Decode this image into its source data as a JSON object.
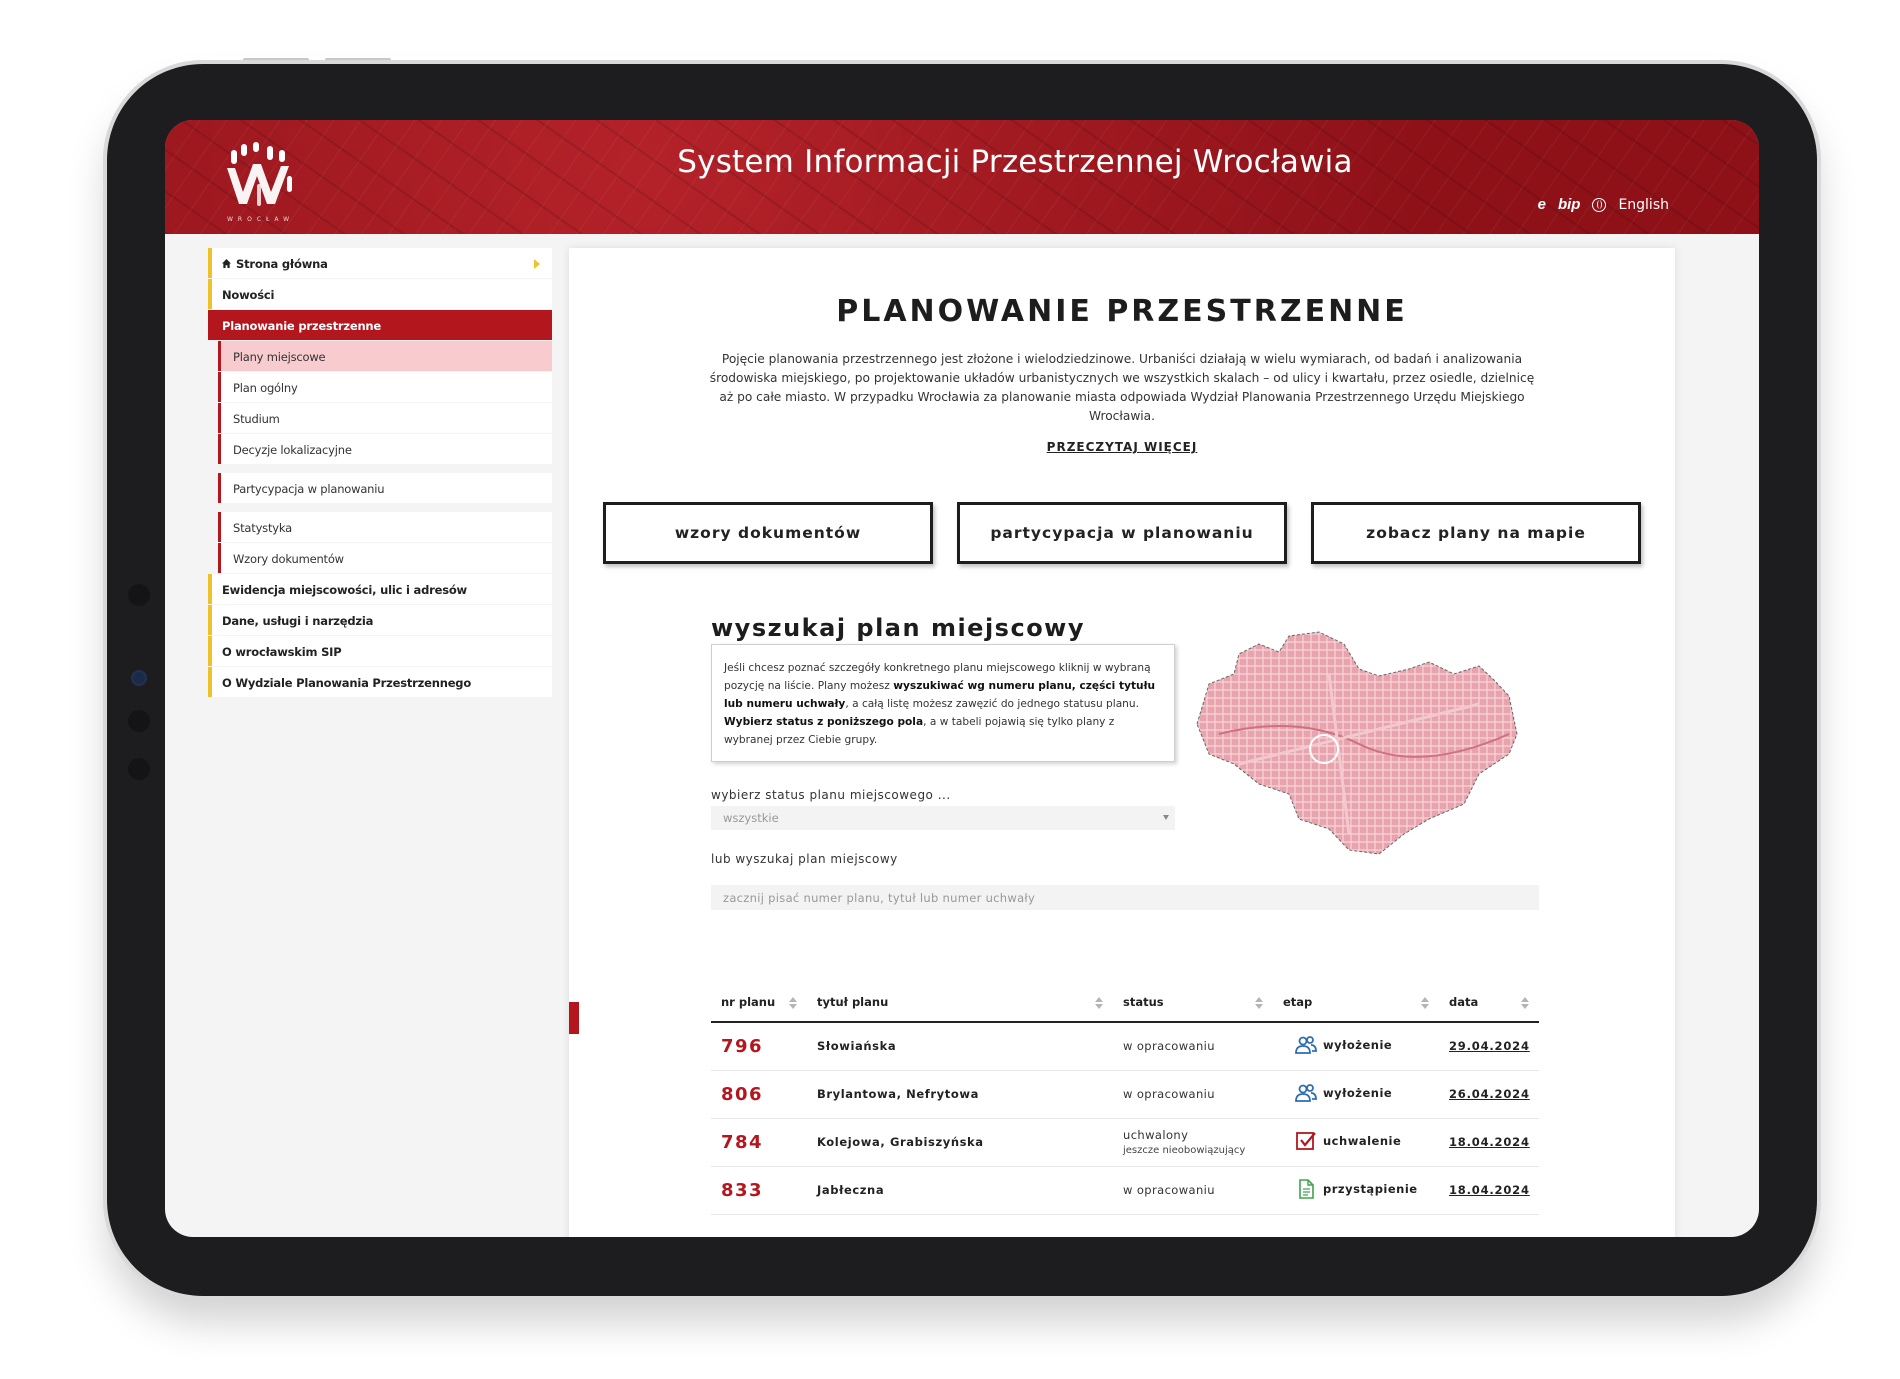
{
  "header": {
    "site_title": "System Informacji Przestrzennej Wrocławia",
    "logo_caption": "WROCŁAW",
    "links": {
      "e_label": "e",
      "bip_label": "bip",
      "lang_label": "English"
    }
  },
  "sidebar": {
    "items": [
      {
        "label": "Strona główna"
      },
      {
        "label": "Nowości"
      },
      {
        "label": "Planowanie przestrzenne"
      }
    ],
    "subitems": [
      {
        "label": "Plany miejscowe"
      },
      {
        "label": "Plan ogólny"
      },
      {
        "label": "Studium"
      },
      {
        "label": "Decyzje lokalizacyjne"
      },
      {
        "label": "Partycypacja w planowaniu"
      },
      {
        "label": "Statystyka"
      },
      {
        "label": "Wzory dokumentów"
      }
    ],
    "bottom_items": [
      {
        "label": "Ewidencja miejscowości, ulic i adresów"
      },
      {
        "label": "Dane, usługi i narzędzia"
      },
      {
        "label": "O wrocławskim SIP"
      },
      {
        "label": "O Wydziale Planowania Przestrzennego"
      }
    ]
  },
  "main": {
    "title": "PLANOWANIE PRZESTRZENNE",
    "intro": "Pojęcie planowania przestrzennego jest złożone i wielodziedzinowe. Urbaniści działają w wielu wymiarach, od badań i analizowania środowiska miejskiego, po projektowanie układów urbanistycznych we wszystkich skalach – od ulicy i kwartału, przez osiedle, dzielnicę aż po całe miasto. W przypadku Wrocławia za planowanie miasta odpowiada Wydział Planowania Przestrzennego Urzędu Miejskiego Wrocławia.",
    "read_more": "PRZECZYTAJ WIĘCEJ",
    "cta": [
      {
        "label": "wzory dokumentów"
      },
      {
        "label": "partycypacja w planowaniu"
      },
      {
        "label": "zobacz plany na mapie"
      }
    ],
    "search_title": "wyszukaj plan miejscowy",
    "info": {
      "p1": "Jeśli chcesz poznać szczegóły konkretnego planu miejscowego kliknij w wybraną pozycję na liście. Plany możesz ",
      "b1": "wyszukiwać wg numeru planu, części tytułu lub numeru uchwały",
      "p2": ", a całą listę możesz zawęzić do jednego statusu planu. ",
      "b2": "Wybierz status z poniższego pola",
      "p3": ", a w tabeli pojawią się tylko plany z wybranej przez Ciebie grupy."
    },
    "status_label": "wybierz status planu miejscowego ...",
    "status_value": "wszystkie",
    "search_label": "lub wyszukaj plan miejscowy",
    "search_placeholder": "zacznij pisać numer planu, tytuł lub numer uchwały"
  },
  "table": {
    "columns": [
      "nr planu",
      "tytuł planu",
      "status",
      "etap",
      "data"
    ],
    "rows": [
      {
        "nr": "796",
        "title": "Słowiańska",
        "status": "w opracowaniu",
        "status_sub": "",
        "stage": "wyłożenie",
        "stage_icon": "people-icon",
        "date": "29.04.2024"
      },
      {
        "nr": "806",
        "title": "Brylantowa, Nefrytowa",
        "status": "w opracowaniu",
        "status_sub": "",
        "stage": "wyłożenie",
        "stage_icon": "people-icon",
        "date": "26.04.2024"
      },
      {
        "nr": "784",
        "title": "Kolejowa, Grabiszyńska",
        "status": "uchwalony",
        "status_sub": "jeszcze nieobowiązujący",
        "stage": "uchwalenie",
        "stage_icon": "checkbox-icon",
        "date": "18.04.2024"
      },
      {
        "nr": "833",
        "title": "Jabłeczna",
        "status": "w opracowaniu",
        "status_sub": "",
        "stage": "przystąpienie",
        "stage_icon": "document-icon",
        "date": "18.04.2024"
      }
    ]
  },
  "colors": {
    "brand_red": "#b4161e",
    "nav_accent": "#f0c229",
    "current_sub": "#f8cbcf",
    "stage_blue": "#2f6db5",
    "stage_green": "#3fa34d"
  }
}
